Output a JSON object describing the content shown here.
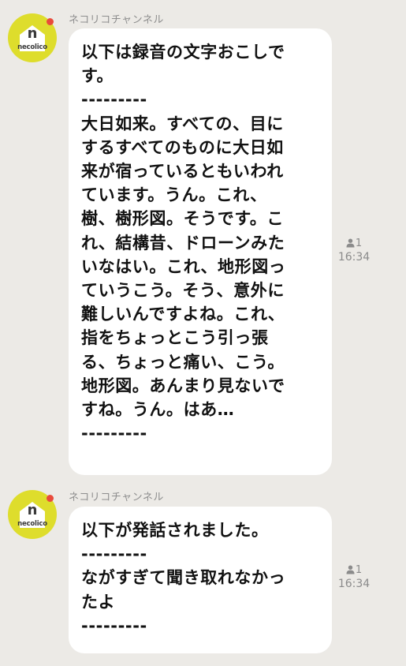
{
  "messages": [
    {
      "sender": "ネコリコチャンネル",
      "avatar_text": "necolico",
      "avatar_letter": "n",
      "lines": [
        "以下は録音の文字おこしで",
        "す。",
        "---------",
        "大日如来。すべての、目に",
        "するすべてのものに大日如",
        "来が宿っているともいわれ",
        "ています。うん。これ、",
        "樹、樹形図。そうです。こ",
        "れ、結構昔、ドローンみた",
        "いなはい。これ、地形図っ",
        "ていうこう。そう、意外に",
        "難しいんですよね。これ、",
        "指をちょっとこう引っ張",
        "る、ちょっと痛い、こう。",
        "地形図。あんまり見ないで",
        "すね。うん。はあ…",
        "---------"
      ],
      "read_count": "1",
      "time": "16:34"
    },
    {
      "sender": "ネコリコチャンネル",
      "avatar_text": "necolico",
      "avatar_letter": "n",
      "lines": [
        "以下が発話されました。",
        "---------",
        "ながすぎて聞き取れなかっ",
        "たよ",
        "---------"
      ],
      "read_count": "1",
      "time": "16:34"
    }
  ],
  "colors": {
    "background": "#eceae6",
    "bubble": "#ffffff",
    "avatar": "#dedd2c",
    "avatar_dot": "#e94b3c",
    "meta_text": "#8b8b8b"
  },
  "icons": {
    "read": "person-icon"
  }
}
